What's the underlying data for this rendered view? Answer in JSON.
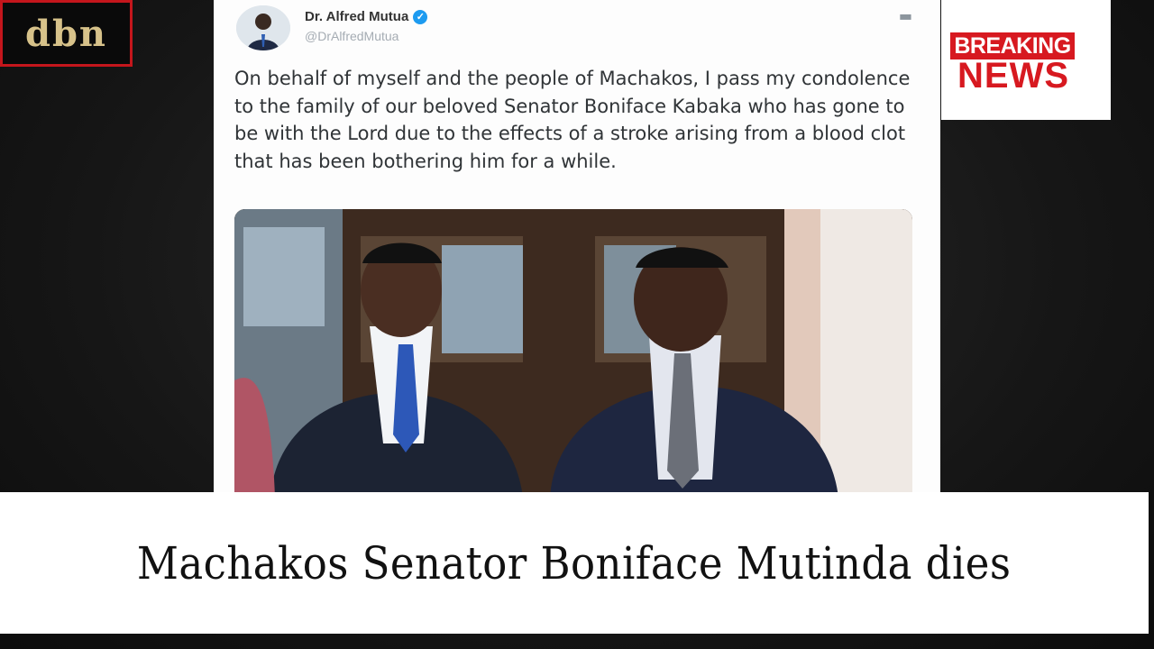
{
  "logo": {
    "text": "dbn"
  },
  "tweet": {
    "author_name": "Dr. Alfred Mutua",
    "handle": "@DrAlfredMutua",
    "more_icon": "more-icon",
    "verified_icon": "verified-badge-icon",
    "text": "On behalf of myself and the people of Machakos, I pass my condolence to the family of our beloved Senator Boniface Kabaka who has gone to be with the Lord due to the effects of a stroke arising from a blood clot that has been bothering him for a while."
  },
  "breaking": {
    "line1": "BREAKING",
    "line2": "NEWS",
    "color": "#d71920"
  },
  "caption": {
    "headline": "Machakos Senator Boniface Mutinda dies"
  }
}
